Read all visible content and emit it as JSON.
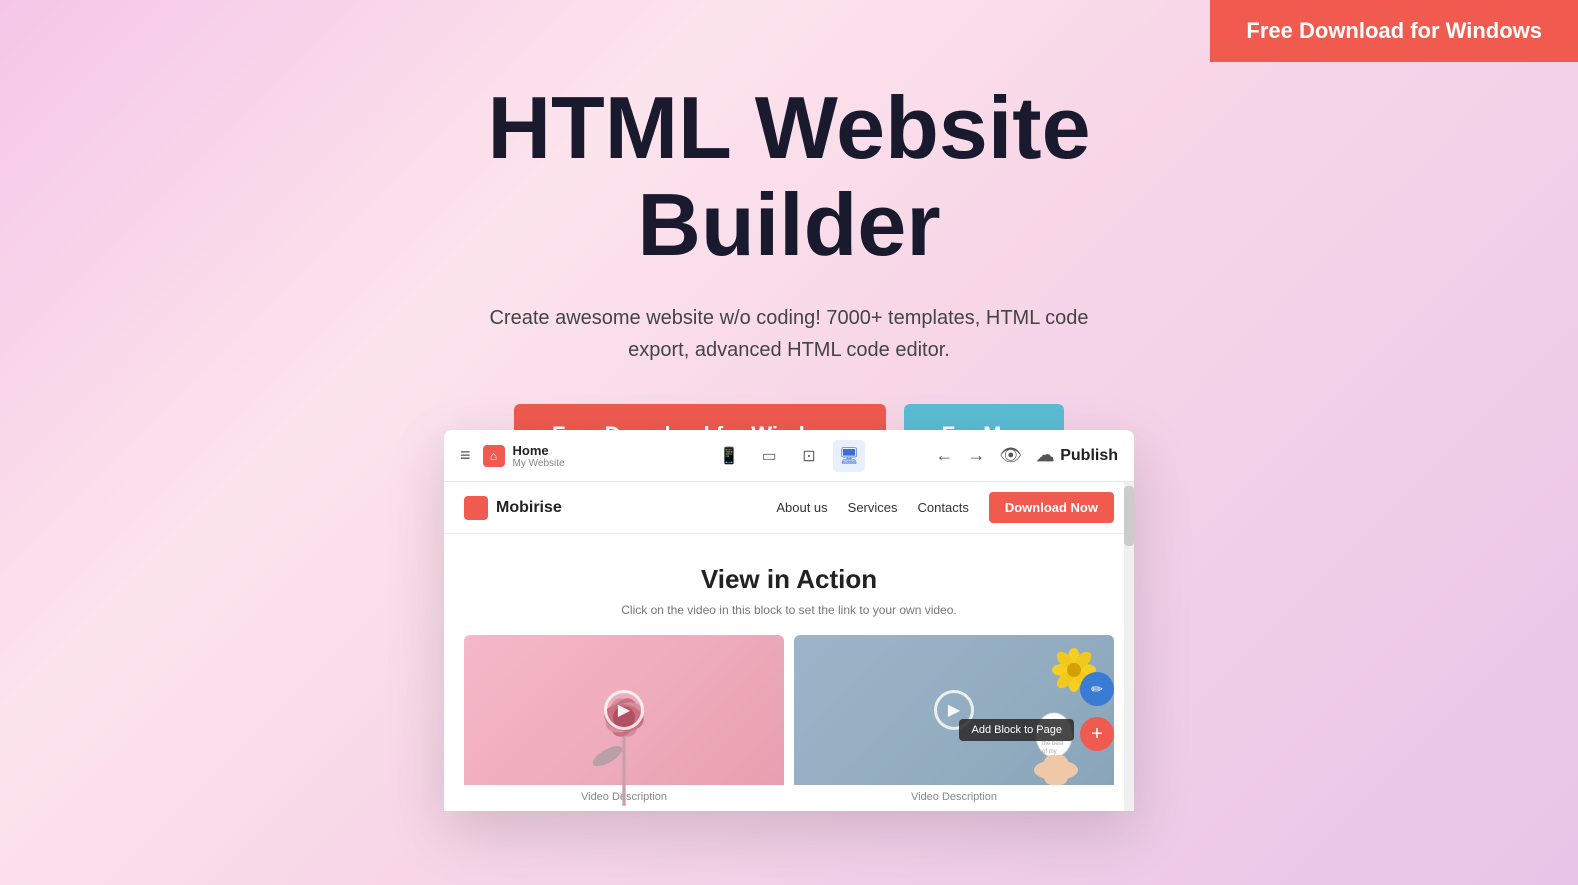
{
  "topCta": {
    "label": "Free Download for Windows"
  },
  "hero": {
    "title": "HTML Website Builder",
    "subtitle": "Create awesome website w/o coding! 7000+ templates, HTML code export, advanced HTML code editor.",
    "btnWindows": "Free Download for Windows",
    "btnMac": "For Mac"
  },
  "appPreview": {
    "toolbar": {
      "hamburgerLabel": "≡",
      "homeTab": {
        "label": "Home",
        "sublabel": "My Website"
      },
      "deviceBtns": [
        {
          "icon": "📱",
          "label": "mobile"
        },
        {
          "icon": "▭",
          "label": "tablet"
        },
        {
          "icon": "⬜",
          "label": "small-desktop"
        },
        {
          "icon": "🖥",
          "label": "desktop",
          "active": true
        }
      ],
      "undoIcon": "←",
      "redoIcon": "→",
      "previewIcon": "👁",
      "publishIcon": "☁",
      "publishLabel": "Publish"
    },
    "innerNav": {
      "brand": "Mobirise",
      "links": [
        "About us",
        "Services",
        "Contacts"
      ],
      "ctaLabel": "Download Now"
    },
    "section": {
      "title": "View in Action",
      "subtitle": "Click on the video in this block to set the link to your own video.",
      "videos": [
        {
          "desc": "Video Description",
          "theme": "pink"
        },
        {
          "desc": "Video Description",
          "theme": "blue"
        }
      ]
    },
    "fabEdit": "✏",
    "addBlockLabel": "Add Block to Page",
    "fabAdd": "+"
  }
}
